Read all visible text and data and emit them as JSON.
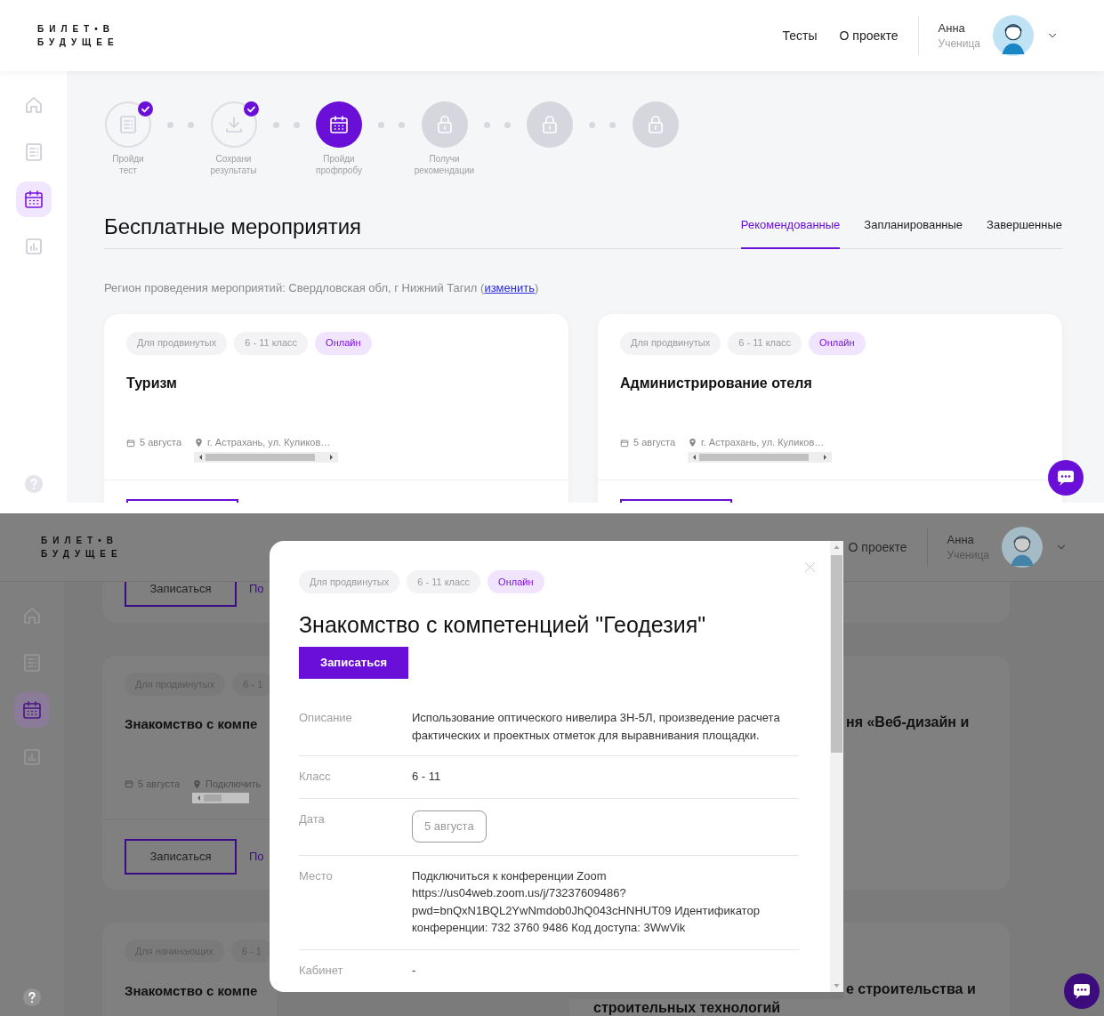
{
  "screen_1": {
    "header": {
      "logo_line_1": "БИЛЕТ•В",
      "logo_line_2": "БУДУЩЕЕ",
      "nav": [
        "Тесты",
        "О проекте"
      ],
      "user_name": "Анна",
      "user_role": "Ученица"
    },
    "sidebar": [
      {
        "kind": "home",
        "selected": false
      },
      {
        "kind": "list",
        "selected": false
      },
      {
        "kind": "calendar",
        "selected": true
      },
      {
        "kind": "chart",
        "selected": false
      }
    ],
    "steps": [
      {
        "kind": "test",
        "completed": true,
        "selected": false,
        "label": "Пройди тест"
      },
      {
        "kind": "download",
        "completed": true,
        "selected": false,
        "label": "Сохрани результаты"
      },
      {
        "kind": "calendar",
        "completed": false,
        "selected": true,
        "label": "Пройди профпробу"
      },
      {
        "kind": "lock",
        "completed": false,
        "selected": false,
        "label": "Получи рекомендации"
      },
      {
        "kind": "lock",
        "completed": false,
        "selected": false
      },
      {
        "kind": "lock",
        "completed": false,
        "selected": false
      }
    ],
    "section_title": "Бесплатные мероприятия",
    "tabs": [
      {
        "label": "Рекомендованные",
        "selected": true
      },
      {
        "label": "Запланированные",
        "selected": false
      },
      {
        "label": "Завершенные",
        "selected": false
      }
    ],
    "region": {
      "text": "Регион проведения мероприятий: Свердловская обл, г Нижний Тагил (",
      "link": "изменить",
      "tail": ")"
    },
    "cards": [
      {
        "tags": [
          {
            "text": "Для продвинутых",
            "accent": false
          },
          {
            "text": "6 - 11 класс",
            "accent": false
          },
          {
            "text": "Онлайн",
            "accent": true
          }
        ],
        "title": "Туризм",
        "date": "5 августа",
        "place": "г. Астрахань, ул. Куликов…"
      },
      {
        "tags": [
          {
            "text": "Для продвинутых",
            "accent": false
          },
          {
            "text": "6 - 11 класс",
            "accent": false
          },
          {
            "text": "Онлайн",
            "accent": true
          }
        ],
        "title": "Администрирование отеля",
        "date": "5 августа",
        "place": "г. Астрахань, ул. Куликов…"
      }
    ]
  },
  "screen_2": {
    "header": {
      "logo_line_1": "БИЛЕТ•В",
      "logo_line_2": "БУДУЩЕЕ",
      "nav": [
        "О проекте"
      ],
      "user_name": "Анна",
      "user_role": "Ученица"
    },
    "sidebar": [
      {
        "kind": "home",
        "selected": false
      },
      {
        "kind": "list",
        "selected": false
      },
      {
        "kind": "calendar",
        "selected": true
      },
      {
        "kind": "chart",
        "selected": false
      }
    ],
    "left_cards": [
      {
        "button": "Записаться",
        "link": "По"
      },
      {
        "tags": [
          {
            "text": "Для продвинутых",
            "accent": false
          },
          {
            "text": "6 - 1",
            "accent": false
          }
        ],
        "title": "Знакомство с компе",
        "date": "5 августа",
        "place": "Подключить",
        "button": "Записаться",
        "link": "По"
      },
      {
        "tags": [
          {
            "text": "Для начинающих",
            "accent": false
          },
          {
            "text": "6 - 1",
            "accent": false
          }
        ],
        "title": "Знакомство с компе"
      }
    ],
    "right_cards": [
      {
        "title": "ня «Веб-дизайн и"
      },
      {
        "title": "е строительства и",
        "title_line_2": "строительных технологий"
      }
    ],
    "modal": {
      "tags": [
        {
          "text": "Для продвинутых",
          "accent": false
        },
        {
          "text": "6 - 11 класс",
          "accent": false
        },
        {
          "text": "Онлайн",
          "accent": true
        }
      ],
      "title": "Знакомство с компетенцией \"Геодезия\"",
      "button": "Записаться",
      "rows": [
        {
          "label": "Описание",
          "value": "Использование оптического нивелира 3Н-5Л, произведение расчета фактических и проектных отметок для выравнивания площадки.",
          "kind": "text"
        },
        {
          "label": "Класс",
          "value": "6 - 11",
          "kind": "text"
        },
        {
          "label": "Дата",
          "value": "5 августа",
          "kind": "chip"
        },
        {
          "label": "Место",
          "value": "Подключиться к конференции Zoom https://us04web.zoom.us/j/73237609486?pwd=bnQxN1BQL2YwNmdob0JhQ043cHNHUT09 Идентификатор конференции: 732 3760 9486 Код доступа: 3WwVik",
          "kind": "text"
        },
        {
          "label": "Кабинет",
          "value": "-",
          "kind": "text"
        }
      ]
    }
  }
}
